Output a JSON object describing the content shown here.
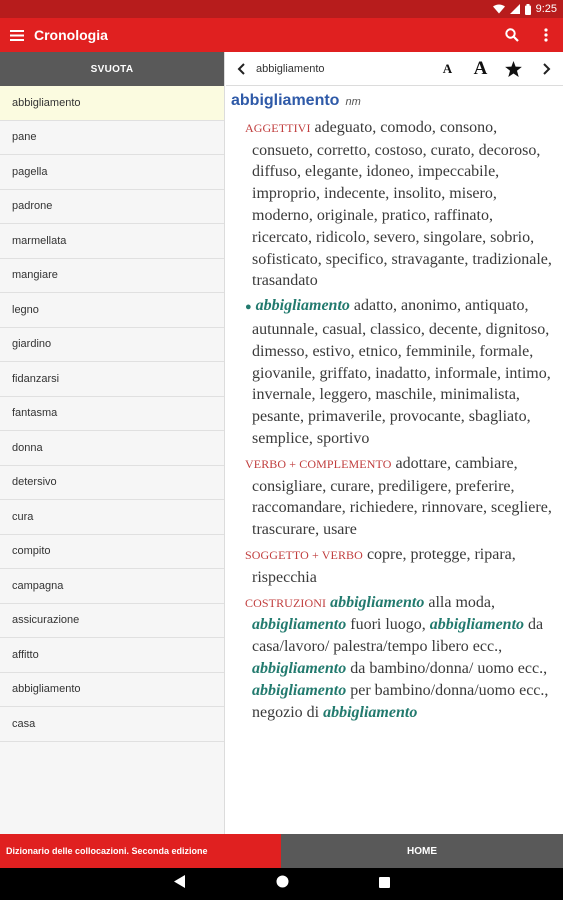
{
  "status": {
    "time": "9:25"
  },
  "app": {
    "title": "Cronologia"
  },
  "history": {
    "clear_label": "SVUOTA",
    "items": [
      "abbigliamento",
      "pane",
      "pagella",
      "padrone",
      "marmellata",
      "mangiare",
      "legno",
      "giardino",
      "fidanzarsi",
      "fantasma",
      "donna",
      "detersivo",
      "cura",
      "compito",
      "campagna",
      "assicurazione",
      "affitto",
      "abbigliamento",
      "casa"
    ]
  },
  "toolbar": {
    "crumb": "abbigliamento",
    "font_small": "A",
    "font_large": "A"
  },
  "entry": {
    "headword": "abbigliamento",
    "pos": "nm",
    "sections": [
      {
        "label": "AGGETTIVI",
        "parts": [
          {
            "t": "adeguato, comodo, consono, consueto, corretto, costoso, curato, decoroso, diffuso, elegante, idoneo, impeccabile, improprio, indecente, insolito, misero, moderno, originale, pratico, raffinato, ricercato, ridicolo, severo, singolare, sobrio, sofisticato, specifico, stravagante, tradizionale, trasandato"
          }
        ]
      },
      {
        "bullet": "●",
        "parts": [
          {
            "hw": "abbigliamento"
          },
          {
            "t": " adatto, anonimo, antiquato, autunnale, casual, classico, decente, dignitoso, dimesso, estivo, etnico, femminile, formale, giovanile, griffato, inadatto, informale, intimo, invernale, leggero, maschile, minimalista, pesante, primaverile, provocante, sbagliato, semplice, sportivo"
          }
        ]
      },
      {
        "label": "VERBO + COMPLEMENTO",
        "parts": [
          {
            "t": "adottare, cambiare, consigliare, curare, prediligere, preferire, raccomandare, richiedere, rinnovare, scegliere, trascurare, usare"
          }
        ]
      },
      {
        "label": "SOGGETTO + VERBO",
        "parts": [
          {
            "t": "copre, protegge, ripara, rispecchia"
          }
        ]
      },
      {
        "label": "COSTRUZIONI",
        "parts": [
          {
            "hw": "abbigliamento"
          },
          {
            "t": " alla moda, "
          },
          {
            "hw": "abbigliamento"
          },
          {
            "t": " fuori luogo, "
          },
          {
            "hw": "abbigliamento"
          },
          {
            "t": " da casa/lavoro/ palestra/tempo libero ecc., "
          },
          {
            "hw": "abbigliamento"
          },
          {
            "t": " da bambino/donna/ uomo ecc., "
          },
          {
            "hw": "abbigliamento"
          },
          {
            "t": " per bambino/donna/uomo ecc., negozio di "
          },
          {
            "hw": "abbigliamento"
          }
        ]
      }
    ]
  },
  "bottom": {
    "left_label": "Dizionario delle collocazioni. Seconda edizione",
    "right_label": "HOME"
  },
  "colors": {
    "primary": "#e02020",
    "status": "#b71c1c",
    "headword": "#2f5aa8",
    "label": "#c03d3d",
    "keyword": "#227a6e",
    "selected": "#fbfbe0"
  }
}
